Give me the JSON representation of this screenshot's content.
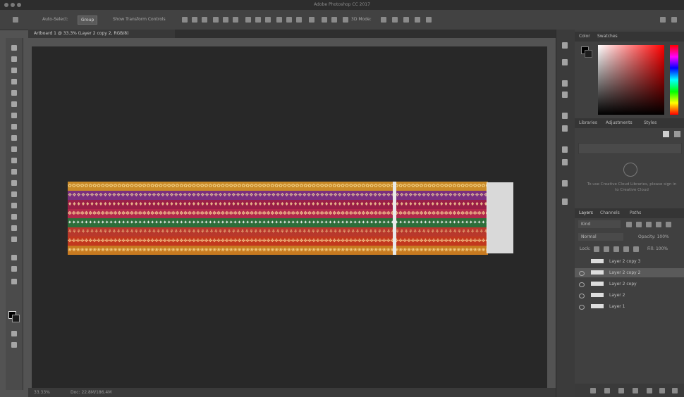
{
  "window": {
    "title": "Adobe Photoshop CC 2017"
  },
  "options_bar": {
    "auto_select_label": "Auto-Select:",
    "auto_select_value": "Group",
    "transform_label": "Show Transform Controls",
    "mode_3d_label": "3D Mode:"
  },
  "document": {
    "tab_label": "Artboard 1 @ 33.3% (Layer 2 copy 2, RGB/8)",
    "status_zoom": "33.33%",
    "status_doc": "Doc: 22.8M/186.4M"
  },
  "right_panel": {
    "color_tabs": [
      "Color",
      "Swatches"
    ],
    "library_tabs": [
      "Libraries",
      "Adjustments",
      "Styles"
    ],
    "library_message": "To use Creative Cloud Libraries, please sign in to Creative Cloud",
    "layers_tabs": [
      "Layers",
      "Channels",
      "Paths"
    ],
    "kind_label": "Kind",
    "blend_mode": "Normal",
    "opacity_label": "Opacity: 100%",
    "lock_label": "Lock:",
    "fill_label": "Fill: 100%",
    "layers": [
      {
        "name": "Layer 2 copy 3",
        "visible": false,
        "selected": false
      },
      {
        "name": "Layer 2 copy 2",
        "visible": true,
        "selected": true
      },
      {
        "name": "Layer 2 copy",
        "visible": true,
        "selected": false
      },
      {
        "name": "Layer 2",
        "visible": true,
        "selected": false
      },
      {
        "name": "Layer 1",
        "visible": true,
        "selected": false
      }
    ]
  },
  "colors": {
    "stripes": [
      "#c98a28",
      "#7a2f7e",
      "#9a1f47",
      "#b1284a",
      "#2d6e3a",
      "#b8382c",
      "#c2381e",
      "#c77a20"
    ]
  }
}
